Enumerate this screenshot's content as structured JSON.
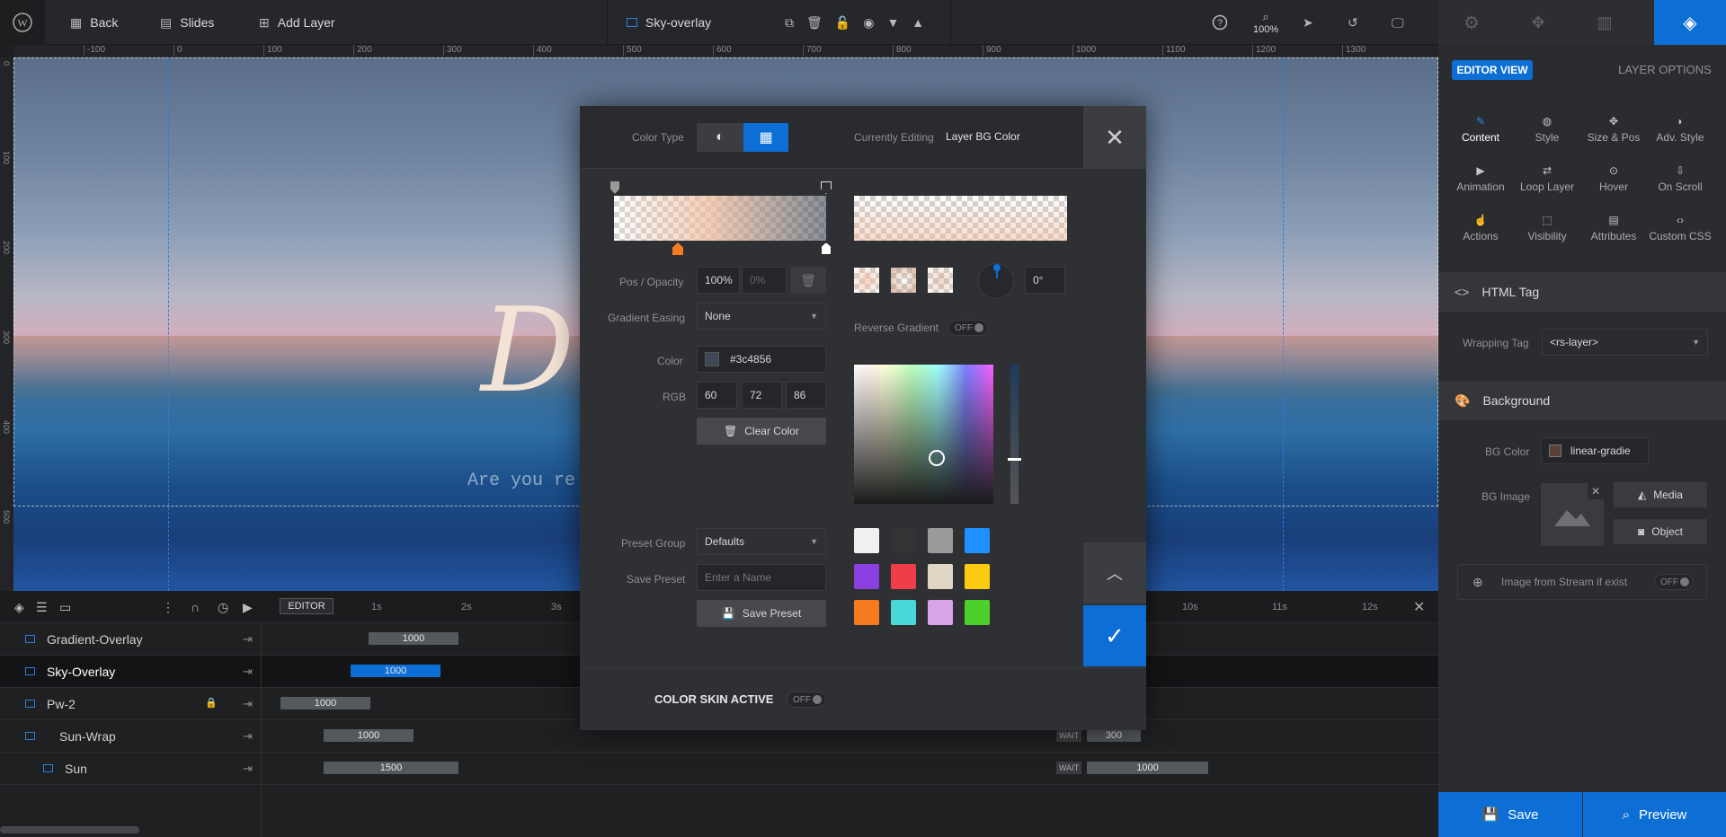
{
  "topbar": {
    "back": "Back",
    "slides": "Slides",
    "add_layer": "Add Layer",
    "layer_name": "Sky-overlay",
    "zoom": "100%"
  },
  "ruler": {
    "ticks": [
      "-100",
      "0",
      "100",
      "200",
      "300",
      "400",
      "500",
      "600",
      "700",
      "800",
      "900",
      "1000",
      "1100",
      "1200",
      "1300"
    ],
    "vticks": [
      "0",
      "100",
      "200",
      "300",
      "400",
      "500"
    ]
  },
  "canvas": {
    "headline": "D",
    "subline": "Are you re"
  },
  "modal": {
    "color_type_label": "Color Type",
    "currently_editing_label": "Currently Editing",
    "currently_editing_value": "Layer BG Color",
    "pos_opacity_label": "Pos / Opacity",
    "pos_value": "100%",
    "opacity_value": "0%",
    "angle_value": "0°",
    "gradient_easing_label": "Gradient Easing",
    "gradient_easing_value": "None",
    "reverse_gradient_label": "Reverse Gradient",
    "reverse_state": "OFF",
    "color_label": "Color",
    "color_hex": "#3c4856",
    "rgb_label": "RGB",
    "rgb": [
      "60",
      "72",
      "86"
    ],
    "clear_color": "Clear Color",
    "preset_group_label": "Preset Group",
    "preset_group_value": "Defaults",
    "save_preset_label": "Save Preset",
    "save_preset_placeholder": "Enter a Name",
    "save_preset_button": "Save Preset",
    "color_skin_label": "COLOR SKIN ACTIVE",
    "color_skin_state": "OFF",
    "presets": [
      "#f0f0f0",
      "#333333",
      "#9a9a9a",
      "#1e90ff",
      "#8a3fe0",
      "#ef3e4a",
      "#e0d6c4",
      "#fccb10",
      "#f47b20",
      "#48d8d8",
      "#d9a3e8",
      "#4cd02c"
    ],
    "accent": "#0d6fd6"
  },
  "panel": {
    "editor_view": "EDITOR VIEW",
    "layer_options": "LAYER OPTIONS",
    "options": [
      {
        "label": "Content",
        "icon": "pencil-icon"
      },
      {
        "label": "Style",
        "icon": "palette-icon"
      },
      {
        "label": "Size & Pos",
        "icon": "move-icon"
      },
      {
        "label": "Adv. Style",
        "icon": "drop-icon"
      },
      {
        "label": "Animation",
        "icon": "play-icon"
      },
      {
        "label": "Loop Layer",
        "icon": "loop-icon"
      },
      {
        "label": "Hover",
        "icon": "mouse-icon"
      },
      {
        "label": "On Scroll",
        "icon": "scroll-icon"
      },
      {
        "label": "Actions",
        "icon": "hand-icon"
      },
      {
        "label": "Visibility",
        "icon": "visibility-icon"
      },
      {
        "label": "Attributes",
        "icon": "file-icon"
      },
      {
        "label": "Custom CSS",
        "icon": "code-icon"
      }
    ],
    "html_tag_title": "HTML Tag",
    "wrapping_tag_label": "Wrapping Tag",
    "wrapping_tag_value": "<rs-layer>",
    "background_title": "Background",
    "bg_color_label": "BG Color",
    "bg_color_value": "linear-gradie",
    "bg_image_label": "BG Image",
    "media_button": "Media",
    "object_button": "Object",
    "stream_label": "Image from Stream if exist",
    "stream_state": "OFF",
    "save": "Save",
    "preview": "Preview"
  },
  "timeline": {
    "editor_label": "EDITOR",
    "time_marks": [
      "1s",
      "2s",
      "3s",
      "10s",
      "11s",
      "12s"
    ],
    "layers": [
      {
        "name": "Gradient-Overlay",
        "duration": "1000"
      },
      {
        "name": "Sky-Overlay",
        "duration": "1000"
      },
      {
        "name": "Pw-2",
        "duration": "1000"
      },
      {
        "name": "Sun-Wrap",
        "duration": "1000",
        "wait_label": "WAIT",
        "wait": "300"
      },
      {
        "name": "Sun",
        "duration": "1500",
        "wait_label": "WAIT",
        "wait": "1000"
      }
    ]
  }
}
